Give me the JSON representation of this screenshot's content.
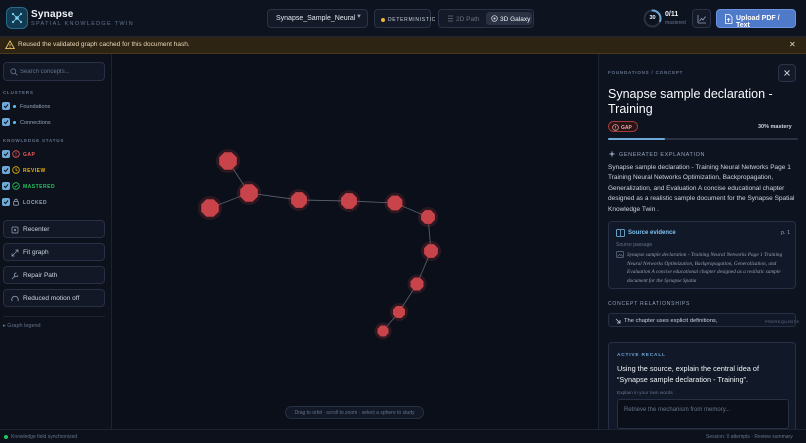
{
  "app": {
    "title": "Synapse",
    "subtitle": "SPATIAL KNOWLEDGE TWIN",
    "logo_icon": "neural-network-icon"
  },
  "topbar": {
    "document_select": {
      "value": "Synapse_Sample_Neural",
      "options_visible": [
        "Synapse_Sample_Neural"
      ]
    },
    "mode_badge": "DETERMINISTIC",
    "view_toggle": [
      {
        "label": "2D Path",
        "icon": "route-icon",
        "active": false
      },
      {
        "label": "3D Galaxy",
        "icon": "orbit-icon",
        "active": true
      }
    ],
    "progress": {
      "ring_value": "30",
      "mastered_count": "0/11",
      "mastered_label": "mastered",
      "fraction": 0.3
    },
    "upload_label": "Upload PDF / Text"
  },
  "notice": {
    "message": "Reused the validated graph cached for this document hash.",
    "close_icon": "close-icon"
  },
  "sidebar": {
    "search_placeholder": "Search concepts...",
    "clusters_heading": "CLUSTERS",
    "clusters": [
      {
        "label": "Foundations",
        "checked": true
      },
      {
        "label": "Connections",
        "checked": true
      }
    ],
    "status_heading": "KNOWLEDGE STATUS",
    "statuses": [
      {
        "label": "GAP",
        "color": "#ef5a5a",
        "icon": "alert-circle-icon",
        "checked": true
      },
      {
        "label": "REVIEW",
        "color": "#eab308",
        "icon": "clock-icon",
        "checked": true
      },
      {
        "label": "MASTERED",
        "color": "#22c55e",
        "icon": "check-circle-icon",
        "checked": true
      },
      {
        "label": "LOCKED",
        "color": "#94a3b8",
        "icon": "lock-icon",
        "checked": true
      }
    ],
    "buttons": [
      {
        "label": "Recenter",
        "icon": "crosshair-icon"
      },
      {
        "label": "Fit graph",
        "icon": "expand-icon"
      },
      {
        "label": "Repair Path",
        "icon": "wrench-icon"
      },
      {
        "label": "Reduced motion off",
        "icon": "pause-circle-icon"
      }
    ],
    "legend_toggle": "▸ Graph legend"
  },
  "canvas": {
    "hint": "Drag to orbit · scroll to zoom · select a sphere to study",
    "node_color": "#c9434a"
  },
  "panel": {
    "breadcrumb": "FOUNDATIONS / CONCEPT",
    "title": "Synapse sample declaration - Training",
    "status_badge": "GAP",
    "mastery_label": "30% mastery",
    "mastery_fraction": 0.3,
    "generated_heading": "GENERATED EXPLANATION",
    "generated_text": "Synapse sample declaration - Training Neural Networks Page 1 Training Neural Networks Optimization, Backpropagation, Generalization, and Evaluation A concise educational chapter designed as a realistic sample document for the Synapse Spatial Knowledge Twin .",
    "evidence": {
      "title": "Source evidence",
      "page": "p. 1",
      "subtitle": "Source passage",
      "quote": "Synapse sample declaration - Training Neural Networks Page 1 Training Neural Networks Optimization, Backpropagation, Generalization, and Evaluation A concise educational chapter designed as a realistic sample document for the Synapse Spatia"
    },
    "relationships_heading": "CONCEPT RELATIONSHIPS",
    "relationships": [
      {
        "label": "The chapter uses explicit definitions,",
        "type": "PREREQUISITE"
      }
    ],
    "recall": {
      "heading": "ACTIVE RECALL",
      "question": "Using the source, explain the central idea of “Synapse sample declaration - Training”.",
      "input_label": "Explain in your own words",
      "placeholder": "Retrieve the mechanism from memory..."
    }
  },
  "footer": {
    "status": "Knowledge field synchronized",
    "session": "Session: 0 attempts ·",
    "summary_link": "Review summary"
  }
}
